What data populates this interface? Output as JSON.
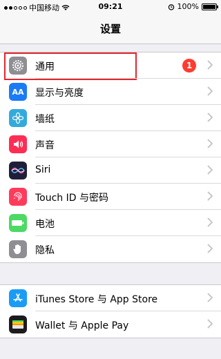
{
  "status_bar": {
    "carrier": "中国移动",
    "time": "09:21",
    "battery": "100%",
    "battery_level": 1.0
  },
  "nav": {
    "title": "设置"
  },
  "groups": [
    {
      "items": [
        {
          "label": "通用",
          "icon": "gear-icon",
          "color": "#8e8e93",
          "badge": "1",
          "highlighted": true
        },
        {
          "label": "显示与亮度",
          "icon": "display-brightness-icon",
          "color": "#1a7cf5",
          "icon_text": "AA"
        },
        {
          "label": "墙纸",
          "icon": "wallpaper-flower-icon",
          "color": "#34aadc"
        },
        {
          "label": "声音",
          "icon": "speaker-icon",
          "color": "#ff2d55"
        },
        {
          "label": "Siri",
          "icon": "siri-icon",
          "color": "#1f1f3a"
        },
        {
          "label": "Touch ID 与密码",
          "icon": "fingerprint-icon",
          "color": "#ff3b5c"
        },
        {
          "label": "电池",
          "icon": "battery-icon",
          "color": "#4cd964"
        },
        {
          "label": "隐私",
          "icon": "hand-icon",
          "color": "#8e8e93"
        }
      ]
    },
    {
      "items": [
        {
          "label": "iTunes Store 与 App Store",
          "icon": "app-store-icon",
          "color": "#1a9cf5"
        },
        {
          "label": "Wallet 与 Apple Pay",
          "icon": "wallet-icon",
          "color": "#1c1c1e"
        }
      ]
    }
  ],
  "colors": {
    "accent_badge": "#ff3b30",
    "highlight_border": "#e0262c",
    "background": "#efeff4"
  }
}
